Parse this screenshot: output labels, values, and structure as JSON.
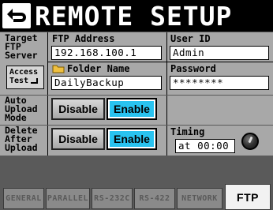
{
  "title": "REMOTE SETUP",
  "labels": {
    "target_ftp_server": [
      "Target",
      "FTP",
      "Server"
    ],
    "auto_upload_mode": [
      "Auto",
      "Upload",
      "Mode"
    ],
    "delete_after_upload": [
      "Delete",
      "After",
      "Upload"
    ]
  },
  "access_test": [
    "Access",
    "Test"
  ],
  "ftp_address": {
    "label": "FTP Address",
    "value": "192.168.100.1"
  },
  "user_id": {
    "label": "User ID",
    "value": "Admin"
  },
  "folder_name": {
    "label": "Folder Name",
    "value": "DailyBackup"
  },
  "password": {
    "label": "Password",
    "value": "********"
  },
  "auto_upload": {
    "disable": "Disable",
    "enable": "Enable",
    "selected": "Enable"
  },
  "delete_after": {
    "disable": "Disable",
    "enable": "Enable",
    "selected": "Enable"
  },
  "timing": {
    "label": "Timing",
    "value": "at 00:00"
  },
  "tabs": [
    {
      "label": "GENERAL",
      "active": false
    },
    {
      "label": "PARALLEL",
      "active": false
    },
    {
      "label": "RS-232C",
      "active": false
    },
    {
      "label": "RS-422",
      "active": false
    },
    {
      "label": "NETWORK",
      "active": false
    },
    {
      "label": "FTP",
      "active": true
    }
  ],
  "colors": {
    "accent": "#29c3f0",
    "panel": "#a8a8a8",
    "background": "#5a5a5a"
  }
}
